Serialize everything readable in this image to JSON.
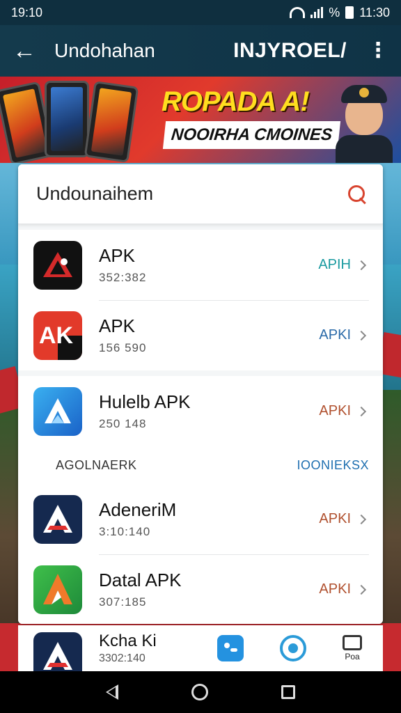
{
  "status_bar": {
    "time_left": "19:10",
    "signal_text": "%",
    "time_right": "11:30"
  },
  "app_bar": {
    "title": "Undohahan",
    "brand": "INJYROEL/",
    "back_icon": "arrow-left-icon",
    "menu_icon": "more-vert-icon"
  },
  "banner": {
    "headline": "ROPADA A!",
    "subline": "NOOIRHA CMOINES"
  },
  "search": {
    "placeholder": "Undounaihem",
    "icon": "search-icon"
  },
  "colors": {
    "accent_red": "#d8442f",
    "teal": "#1a9aa0",
    "link_blue": "#1e6fb0",
    "tag_brown": "#b0502e"
  },
  "apps_group_1": [
    {
      "name": "APK",
      "size": "352:382",
      "tag": "APIH",
      "tag_color": "#1a9aa0"
    },
    {
      "name": "APK",
      "size": "156 590",
      "tag": "APKI",
      "tag_color": "#2a6aa8"
    }
  ],
  "apps_group_2": [
    {
      "name": "Hulelb APK",
      "size": "250 148",
      "tag": "APKI",
      "tag_color": "#b0502e"
    }
  ],
  "section": {
    "label": "AGOLNAERK",
    "link": "IOONIEKSX"
  },
  "apps_group_3": [
    {
      "name": "AdeneriM",
      "size": "3:10:140",
      "tag": "APKI",
      "tag_color": "#b0502e"
    },
    {
      "name": "Datal APK",
      "size": "307:185",
      "tag": "APKI",
      "tag_color": "#b0502e"
    }
  ],
  "bottom": {
    "name": "Kcha Ki",
    "size": "3302:140",
    "nav_label": "Poa"
  }
}
